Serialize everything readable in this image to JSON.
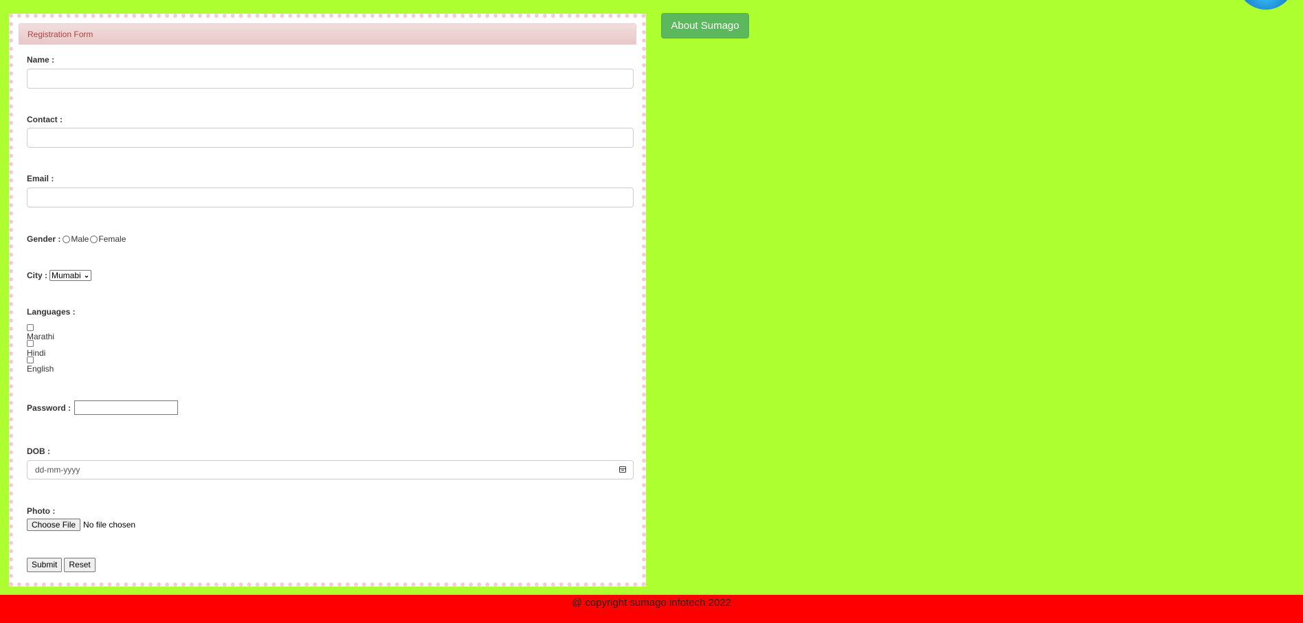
{
  "form": {
    "heading": "Registration Form",
    "name_label": "Name :",
    "contact_label": "Contact :",
    "email_label": "Email :",
    "gender_label": "Gender :",
    "gender_options": [
      "Male",
      "Female"
    ],
    "city_label": "City :",
    "city_selected": "Mumabi",
    "languages_label": "Languages :",
    "languages": [
      "Marathi",
      "Hindi",
      "English"
    ],
    "password_label": "Password :",
    "dob_label": "DOB :",
    "dob_placeholder": "dd-mm-yyyy",
    "photo_label": "Photo :",
    "choose_file_label": "Choose File",
    "file_status": "No file chosen",
    "submit_label": "Submit",
    "reset_label": "Reset"
  },
  "about_button": "About Sumago",
  "footer": {
    "text": "@ copyright sumago infotech 2022"
  },
  "colors": {
    "page_background": "#adff2f",
    "footer_background": "#ff0000",
    "about_button": "#5cb85c",
    "heading_text": "#a94442"
  }
}
